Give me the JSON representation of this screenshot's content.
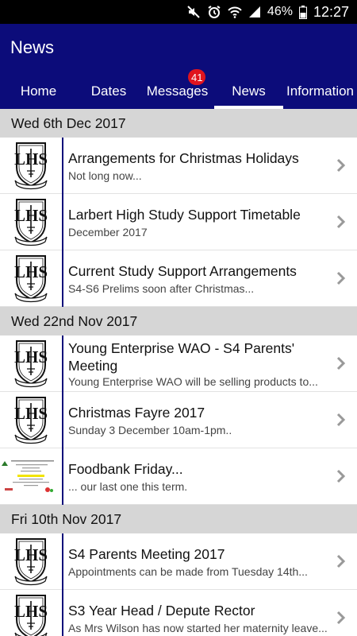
{
  "status_bar": {
    "icons": [
      "mute-icon",
      "alarm-icon",
      "wifi-icon",
      "signal-icon"
    ],
    "battery": "46%",
    "time": "12:27"
  },
  "header": {
    "title": "News",
    "tabs": [
      {
        "label": "Home",
        "active": false
      },
      {
        "label": "Dates",
        "active": false
      },
      {
        "label": "Messages",
        "active": false,
        "badge": "41"
      },
      {
        "label": "News",
        "active": true
      },
      {
        "label": "Information",
        "active": false
      }
    ]
  },
  "news": [
    {
      "date": "Wed 6th Dec 2017",
      "items": [
        {
          "title": "Arrangements for Christmas Holidays",
          "subtitle": "Not long now...",
          "thumb": "school-crest"
        },
        {
          "title": "Larbert High Study Support Timetable",
          "subtitle": "December 2017",
          "thumb": "school-crest"
        },
        {
          "title": "Current Study Support Arrangements",
          "subtitle": "S4-S6 Prelims soon after Christmas...",
          "thumb": "school-crest"
        }
      ]
    },
    {
      "date": "Wed 22nd Nov 2017",
      "items": [
        {
          "title": "Young Enterprise WAO - S4 Parents' Meeting",
          "subtitle": "Young Enterprise WAO will be selling products to...",
          "thumb": "school-crest"
        },
        {
          "title": "Christmas Fayre 2017",
          "subtitle": "Sunday 3 December 10am-1pm..",
          "thumb": "school-crest"
        },
        {
          "title": "Foodbank Friday...",
          "subtitle": "... our last one this term.",
          "thumb": "poster"
        }
      ]
    },
    {
      "date": "Fri 10th Nov 2017",
      "items": [
        {
          "title": "S4 Parents Meeting 2017",
          "subtitle": "Appointments can be made from Tuesday 14th...",
          "thumb": "school-crest"
        },
        {
          "title": "S3 Year Head / Depute Rector",
          "subtitle": "As Mrs Wilson has now started her maternity leave...",
          "thumb": "school-crest"
        }
      ]
    }
  ],
  "colors": {
    "brand": "#0c0c7a",
    "badge": "#e0141e",
    "section_bg": "#d6d6d6"
  }
}
